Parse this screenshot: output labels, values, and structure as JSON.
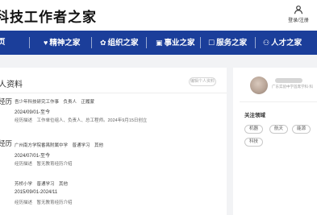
{
  "header": {
    "site_title": "科技工作者之家",
    "login_label": "登录/注册"
  },
  "nav": {
    "items": [
      {
        "icon": "",
        "label": "页"
      },
      {
        "icon": "♥",
        "label": "精神之家"
      },
      {
        "icon": "✿",
        "label": "组织之家"
      },
      {
        "icon": "▣",
        "label": "事业之家"
      },
      {
        "icon": "☐",
        "label": "服务之家"
      },
      {
        "icon": "⚇",
        "label": "人才之家"
      }
    ]
  },
  "profile_card": {
    "title": "人资料",
    "edit_label": "编辑个人资料",
    "sections": [
      {
        "label": "经历",
        "lines": [
          "吾少年科技研究工作事　负责人　正履蒙",
          "2024/09/01-至今",
          "经历描述　工作单位组人、负责人、总工程师。2024年9月15日创立"
        ]
      },
      {
        "label": "经历",
        "lines": [
          "广州南方学院番禺附属中学　普通学习　其他",
          "2024/07/01-至今",
          "经历描述　暂无教育经历介绍"
        ]
      },
      {
        "label": "",
        "lines": [
          "芳桥小学　普通学习　其他",
          "2015/09/01-2024/11",
          "经历描述　暂无教育经历介绍"
        ]
      }
    ]
  },
  "side_card": {
    "subtitle": "广东实验中学首席学科·科",
    "field_title": "关注领域",
    "tags": [
      "机器",
      "航天",
      "能源",
      "科技"
    ]
  }
}
